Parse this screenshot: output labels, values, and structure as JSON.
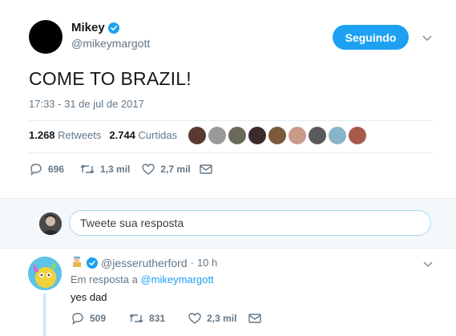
{
  "tweet": {
    "author_name": "Mikey",
    "author_handle": "@mikeymargott",
    "follow_label": "Seguindo",
    "text": "COME TO BRAZIL!",
    "timestamp": "17:33 - 31 de jul de 2017",
    "retweets_count": "1.268",
    "retweets_label": "Retweets",
    "likes_count": "2.744",
    "likes_label": "Curtidas",
    "actions": {
      "replies": "696",
      "retweets": "1,3 mil",
      "likes": "2,7 mil"
    }
  },
  "reply_box": {
    "placeholder": "Tweete sua resposta"
  },
  "reply": {
    "handle": "@jesserutherford",
    "separator": "·",
    "time": "10 h",
    "in_reply_prefix": "Em resposta a",
    "in_reply_to": "@mikeymargott",
    "text": "yes dad",
    "actions": {
      "replies": "509",
      "retweets": "831",
      "likes": "2,3 mil"
    }
  },
  "colors": {
    "accent": "#1da1f2",
    "muted": "#657786",
    "border": "#e6ecf0"
  },
  "icons": [
    "verified-badge-icon",
    "chevron-down-icon",
    "reply-icon",
    "retweet-icon",
    "like-icon",
    "message-icon"
  ]
}
